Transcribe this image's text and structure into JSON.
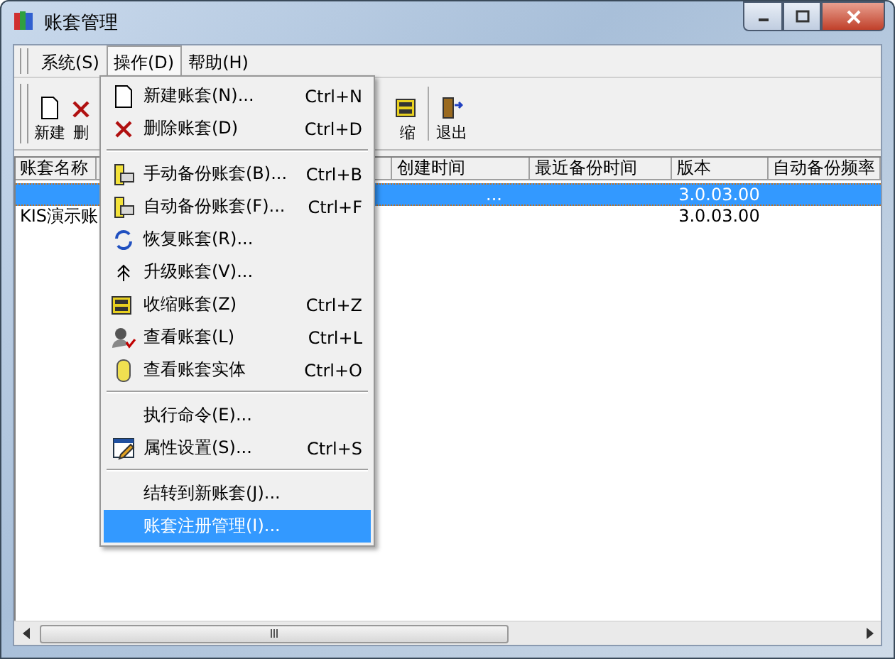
{
  "window": {
    "title": "账套管理"
  },
  "menubar": [
    {
      "label": "系统(S)",
      "selected": false
    },
    {
      "label": "操作(D)",
      "selected": true
    },
    {
      "label": "帮助(H)",
      "selected": false
    }
  ],
  "toolbar": [
    {
      "kind": "new",
      "label": "新建"
    },
    {
      "kind": "delete",
      "label": "删"
    },
    {
      "kind": "shrink",
      "label": "缩"
    },
    {
      "kind": "exit",
      "label": "退出"
    }
  ],
  "table": {
    "columns": [
      {
        "label": "账套名称"
      },
      {
        "label": "创建时间"
      },
      {
        "label": "最近备份时间"
      },
      {
        "label": "版本"
      },
      {
        "label": "自动备份频率"
      }
    ],
    "rows": [
      {
        "selected": true,
        "created": "...",
        "version": "3.0.03.00"
      },
      {
        "selected": false,
        "name": "KIS演示账",
        "version": "3.0.03.00"
      }
    ]
  },
  "menu": {
    "items": [
      {
        "kind": "new",
        "label": "新建账套(N)...",
        "shortcut": "Ctrl+N",
        "selected": false
      },
      {
        "kind": "delete",
        "label": "删除账套(D)",
        "shortcut": "Ctrl+D",
        "selected": false
      },
      {
        "kind": "separator"
      },
      {
        "kind": "backup",
        "label": "手动备份账套(B)...",
        "shortcut": "Ctrl+B",
        "selected": false
      },
      {
        "kind": "backup",
        "label": "自动备份账套(F)...",
        "shortcut": "Ctrl+F",
        "selected": false
      },
      {
        "kind": "restore",
        "label": "恢复账套(R)...",
        "selected": false
      },
      {
        "kind": "upgrade",
        "label": "升级账套(V)...",
        "selected": false
      },
      {
        "kind": "shrink",
        "label": "收缩账套(Z)",
        "shortcut": "Ctrl+Z",
        "selected": false
      },
      {
        "kind": "view",
        "label": "查看账套(L)",
        "shortcut": "Ctrl+L",
        "selected": false
      },
      {
        "kind": "entity",
        "label": "查看账套实体",
        "shortcut": "Ctrl+O",
        "selected": false
      },
      {
        "kind": "separator"
      },
      {
        "kind": "plain",
        "label": "执行命令(E)...",
        "selected": false
      },
      {
        "kind": "properties",
        "label": "属性设置(S)...",
        "shortcut": "Ctrl+S",
        "selected": false
      },
      {
        "kind": "separator"
      },
      {
        "kind": "plain",
        "label": "结转到新账套(J)...",
        "selected": false
      },
      {
        "kind": "plain",
        "label": "账套注册管理(I)...",
        "selected": true
      }
    ]
  }
}
